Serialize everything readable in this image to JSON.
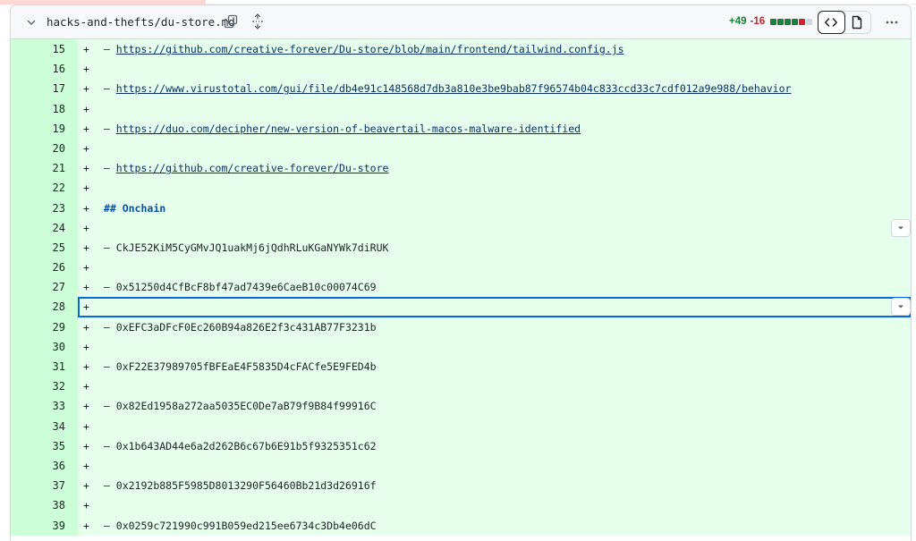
{
  "file": {
    "path": "hacks-and-thefts/du-store.md",
    "additions": "+49",
    "deletions": "-16",
    "diffstat_colors": [
      "#1a7f37",
      "#1a7f37",
      "#1a7f37",
      "#1a7f37",
      "#cf222e",
      "#d0d7de"
    ]
  },
  "icons": {
    "collapse": "chevron-down-icon",
    "copy": "copy-icon",
    "expand": "unfold-icon",
    "code_view": "code-icon",
    "rich_view": "file-icon",
    "more": "kebab-horizontal-icon"
  },
  "lines": [
    {
      "num": "15",
      "marker": "+",
      "prefix": " – ",
      "text": "https://github.com/creative-forever/Du-store/blob/main/frontend/tailwind.config.js",
      "kind": "link"
    },
    {
      "num": "16",
      "marker": "+",
      "prefix": "",
      "text": "",
      "kind": "plain"
    },
    {
      "num": "17",
      "marker": "+",
      "prefix": " – ",
      "text": "https://www.virustotal.com/gui/file/db4e91c148568d7db3a810e3be9bab87f96574b04c833ccd33c7cdf012a9e988/behavior",
      "kind": "link"
    },
    {
      "num": "18",
      "marker": "+",
      "prefix": "",
      "text": "",
      "kind": "plain"
    },
    {
      "num": "19",
      "marker": "+",
      "prefix": " – ",
      "text": "https://duo.com/decipher/new-version-of-beavertail-macos-malware-identified",
      "kind": "link"
    },
    {
      "num": "20",
      "marker": "+",
      "prefix": "",
      "text": "",
      "kind": "plain"
    },
    {
      "num": "21",
      "marker": "+",
      "prefix": " – ",
      "text": "https://github.com/creative-forever/Du-store",
      "kind": "link"
    },
    {
      "num": "22",
      "marker": "+",
      "prefix": "",
      "text": "",
      "kind": "plain"
    },
    {
      "num": "23",
      "marker": "+",
      "prefix": " ",
      "text": "## Onchain",
      "kind": "heading"
    },
    {
      "num": "24",
      "marker": "+",
      "prefix": "",
      "text": "",
      "kind": "plain"
    },
    {
      "num": "25",
      "marker": "+",
      "prefix": " – ",
      "text": "CkJE52KiM5CyGMvJQ1uakMj6jQdhRLuKGaNYWk7diRUK",
      "kind": "plain"
    },
    {
      "num": "26",
      "marker": "+",
      "prefix": "",
      "text": "",
      "kind": "plain"
    },
    {
      "num": "27",
      "marker": "+",
      "prefix": " – ",
      "text": "0x51250d4CfBcF8bf47ad7439e6CaeB10c00074C69",
      "kind": "plain"
    },
    {
      "num": "28",
      "marker": "+",
      "prefix": "",
      "text": "",
      "kind": "plain"
    },
    {
      "num": "29",
      "marker": "+",
      "prefix": " – ",
      "text": "0xEFC3aDFcF0Ec260B94a826E2f3c431AB77F3231b",
      "kind": "plain"
    },
    {
      "num": "30",
      "marker": "+",
      "prefix": "",
      "text": "",
      "kind": "plain"
    },
    {
      "num": "31",
      "marker": "+",
      "prefix": " – ",
      "text": "0xF22E37989705fBFEaE4F5835D4cFACfe5E9FED4b",
      "kind": "plain"
    },
    {
      "num": "32",
      "marker": "+",
      "prefix": "",
      "text": "",
      "kind": "plain"
    },
    {
      "num": "33",
      "marker": "+",
      "prefix": " – ",
      "text": "0x82Ed1958a272aa5035EC0De7aB79f9B84f99916C",
      "kind": "plain"
    },
    {
      "num": "34",
      "marker": "+",
      "prefix": "",
      "text": "",
      "kind": "plain"
    },
    {
      "num": "35",
      "marker": "+",
      "prefix": " – ",
      "text": "0x1b643AD44e6a2d262B6c67b6E91b5f9325351c62",
      "kind": "plain"
    },
    {
      "num": "36",
      "marker": "+",
      "prefix": "",
      "text": "",
      "kind": "plain"
    },
    {
      "num": "37",
      "marker": "+",
      "prefix": " – ",
      "text": "0x2192b885F5985D8013290F56460Bb21d3d26916f",
      "kind": "plain"
    },
    {
      "num": "38",
      "marker": "+",
      "prefix": "",
      "text": "",
      "kind": "plain"
    },
    {
      "num": "39",
      "marker": "+",
      "prefix": " – ",
      "text": "0x0259c721990c991B059ed215ee6734c3Db4e06dC",
      "kind": "plain"
    }
  ]
}
